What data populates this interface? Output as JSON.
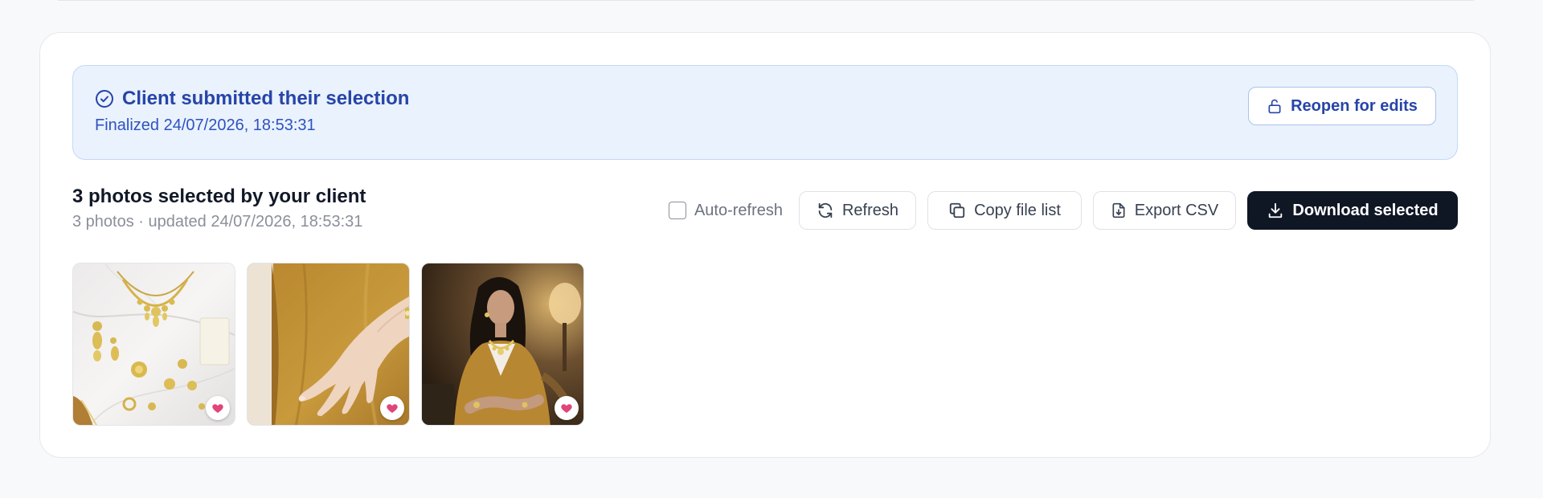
{
  "banner": {
    "title": "Client submitted their selection",
    "subtitle": "Finalized 24/07/2026, 18:53:31",
    "reopen_label": "Reopen for edits",
    "icon": "check-circle-icon"
  },
  "selection": {
    "title": "3 photos selected by your client",
    "subtitle": "3 photos · updated 24/07/2026, 18:53:31"
  },
  "toolbar": {
    "auto_refresh_label": "Auto-refresh",
    "auto_refresh_checked": false,
    "refresh_label": "Refresh",
    "copy_label": "Copy file list",
    "export_label": "Export CSV",
    "download_label": "Download selected"
  },
  "photos": [
    {
      "subject": "jewelry flat-lay on marble",
      "favorited": true
    },
    {
      "subject": "hand with ring on mustard fabric",
      "favorited": true
    },
    {
      "subject": "woman in mustard blazer with necklace",
      "favorited": true
    }
  ],
  "colors": {
    "accent_blue": "#2744a8",
    "banner_bg": "#eaf2fd",
    "dark_button": "#0f1624",
    "heart": "#e0457b"
  }
}
